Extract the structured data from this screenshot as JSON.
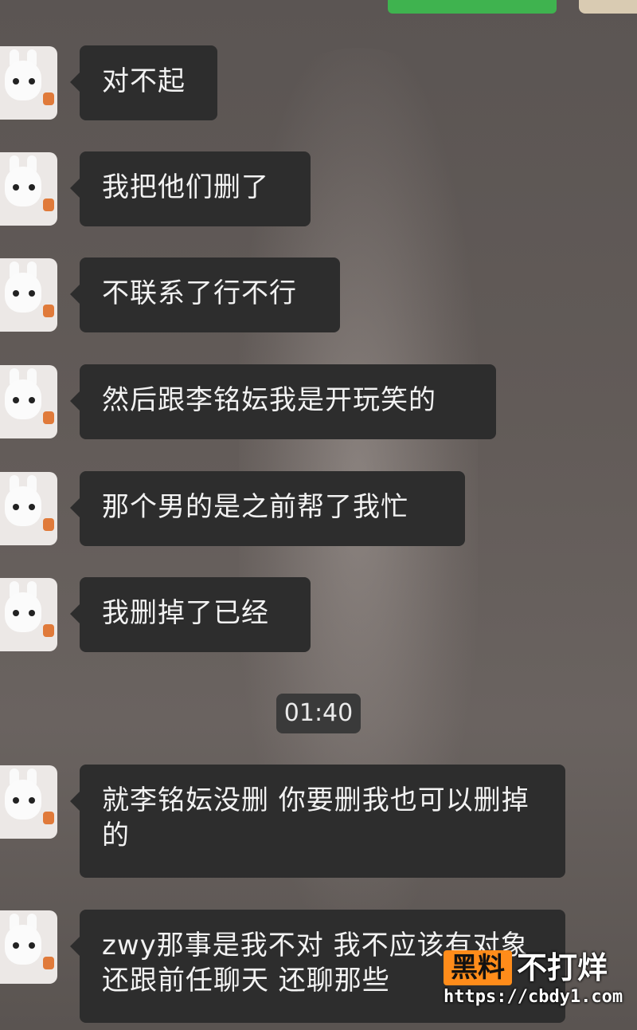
{
  "messages": [
    {
      "text": "对不起"
    },
    {
      "text": "我把他们删了"
    },
    {
      "text": "不联系了行不行"
    },
    {
      "text": "然后跟李铭妘我是开玩笑的"
    },
    {
      "text": "那个男的是之前帮了我忙"
    },
    {
      "text": "我删掉了已经"
    },
    {
      "text": "就李铭妘没删 你要删我也可以删掉的"
    },
    {
      "text": "zwy那事是我不对 我不应该有对象还跟前任聊天 还聊那些"
    }
  ],
  "timestamp": "01:40",
  "watermark": {
    "badge": "黑料",
    "slogan": "不打烊",
    "url": "https://cbdy1.com"
  },
  "colors": {
    "bubble": "#2d2d2d",
    "bubble_text": "#f2f2f2",
    "wechat_green": "#3fb34f",
    "watermark_orange": "#ff8c1a"
  }
}
